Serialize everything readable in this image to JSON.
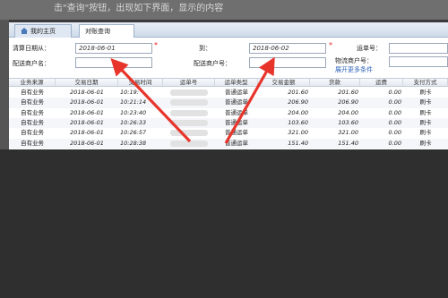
{
  "background_caption": "击\"查询\"按钮，出现如下界面，显示的内容",
  "tabs": [
    {
      "label": "我的主页",
      "icon": "home-icon"
    },
    {
      "label": "对账查询"
    }
  ],
  "form": {
    "settle_date_from_label": "清算日期从：",
    "settle_date_from_value": "2018-06-01",
    "to_label": "到：",
    "settle_date_to_value": "2018-06-02",
    "waybill_no_label": "运单号：",
    "merchant_name_label": "配送商户名：",
    "merchant_no_label": "配送商户号：",
    "logistics_merchant_label": "物流商户号：",
    "more_conditions_link": "展开更多条件"
  },
  "table": {
    "columns": [
      "业务来源",
      "交易日期",
      "交易时间",
      "运单号",
      "运单类型",
      "交易金额",
      "货款",
      "运费",
      "支付方式"
    ],
    "rows": [
      [
        "自有业务",
        "2018-06-01",
        "10:19:",
        "",
        "普通运单",
        "201.60",
        "201.60",
        "0.00",
        "刷卡"
      ],
      [
        "自有业务",
        "2018-06-01",
        "10:21:14",
        "",
        "普通运单",
        "206.90",
        "206.90",
        "0.00",
        "刷卡"
      ],
      [
        "自有业务",
        "2018-06-01",
        "10:23:40",
        "",
        "普通运单",
        "204.00",
        "204.00",
        "0.00",
        "刷卡"
      ],
      [
        "自有业务",
        "2018-06-01",
        "10:26:33",
        "",
        "普通运单",
        "103.60",
        "103.60",
        "0.00",
        "刷卡"
      ],
      [
        "自有业务",
        "2018-06-01",
        "10:26:57",
        "",
        "普通运单",
        "321.00",
        "321.00",
        "0.00",
        "刷卡"
      ],
      [
        "自有业务",
        "2018-06-01",
        "10:28:38",
        "",
        "普通运单",
        "151.40",
        "151.40",
        "0.00",
        "刷卡"
      ],
      [
        "自有业务",
        "2018-06-01",
        "10:30:46",
        "",
        "普通运单",
        "440.00",
        "440.00",
        "0.00",
        "刷卡"
      ]
    ]
  },
  "colors": {
    "arrow": "#e8352b",
    "required": "#e02020",
    "link": "#2c63b8"
  }
}
